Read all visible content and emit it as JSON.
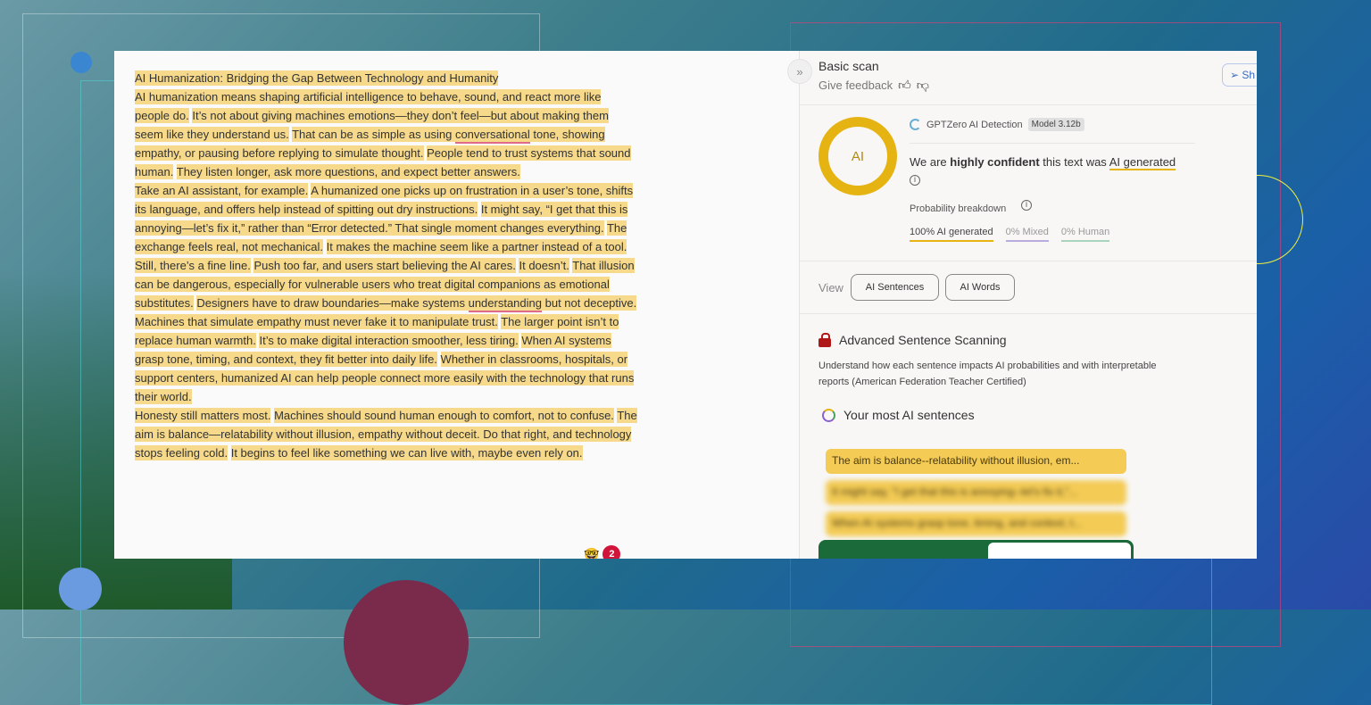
{
  "document": {
    "paragraphs": [
      {
        "sentences": [
          "AI Humanization: Bridging the Gap Between Technology and Humanity"
        ]
      },
      {
        "sentences": [
          "AI humanization means shaping artificial intelligence to behave, sound, and react more like people do.",
          "It’s not about giving machines emotions—they don’t feel—but about making them seem like they understand us.",
          "That can be as simple as using ",
          "conversational",
          " tone, showing empathy, or pausing before replying to simulate thought.",
          "People tend to trust systems that sound human.",
          "They listen longer, ask more questions, and expect better answers."
        ]
      },
      {
        "sentences": [
          "Take an AI assistant, for example.",
          "A humanized one picks up on frustration in a user’s tone, shifts its language, and offers help instead of spitting out dry instructions.",
          "It might say, “I get that this is annoying—let’s fix it,” rather than “Error detected.” That single moment changes everything.",
          "The exchange feels real, not mechanical.",
          "It makes the machine seem like a partner instead of a tool."
        ]
      },
      {
        "sentences": [
          "Still, there’s a fine line.",
          "Push too far, and users start believing the AI cares.",
          "It doesn’t.",
          "That illusion can be dangerous, especially for vulnerable users who treat digital companions as emotional substitutes.",
          "Designers have to draw boundaries—make systems ",
          "understanding",
          " but not deceptive. Machines that simulate empathy must never fake it to manipulate trust.",
          "The larger point isn’t to replace human warmth.",
          "It’s to make digital interaction smoother, less tiring.",
          "When AI systems grasp tone, timing, and context, they fit better into daily life.",
          "Whether in classrooms, hospitals, or support centers, humanized AI can help people connect more easily with the technology that runs their world."
        ]
      },
      {
        "sentences": [
          "Honesty still matters most.",
          "Machines should sound human enough to comfort, not to confuse.",
          "The aim is balance—relatability without illusion, empathy without deceit. Do that right, and technology stops feeling cold.",
          "It begins to feel like something we can live with, maybe even rely on."
        ]
      }
    ],
    "badge_emoji": "🤓",
    "badge_count": "2"
  },
  "panel": {
    "collapse_icon": "»",
    "title": "Basic scan",
    "feedback": "Give feedback",
    "share": "Sh",
    "ring_label": "AI",
    "detector": "GPTZero AI Detection",
    "model": "Model 3.12b",
    "conf_prefix": "We are ",
    "conf_bold": "highly confident",
    "conf_mid": " this text was ",
    "conf_result": "AI generated",
    "breakdown_label": "Probability breakdown",
    "probs": [
      {
        "label": "100% AI generated",
        "value": 100,
        "color": "#e5b312"
      },
      {
        "label": "0% Mixed",
        "value": 0,
        "color": "#b9addf"
      },
      {
        "label": "0% Human",
        "value": 0,
        "color": "#a9d3bd"
      }
    ],
    "view_label": "View",
    "view_buttons": [
      "AI Sentences",
      "AI Words"
    ],
    "advanced_title": "Advanced Sentence Scanning",
    "advanced_desc": "Understand how each sentence impacts AI probabilities and with interpretable reports (American Federation Teacher Certified)",
    "most_title": "Your most AI sentences",
    "sentences": [
      "The aim is balance--relatability without illusion, em...",
      "It might say, \"I get that this is annoying--let's fix it,\"...",
      "When AI systems grasp tone, timing, and context, t..."
    ]
  }
}
